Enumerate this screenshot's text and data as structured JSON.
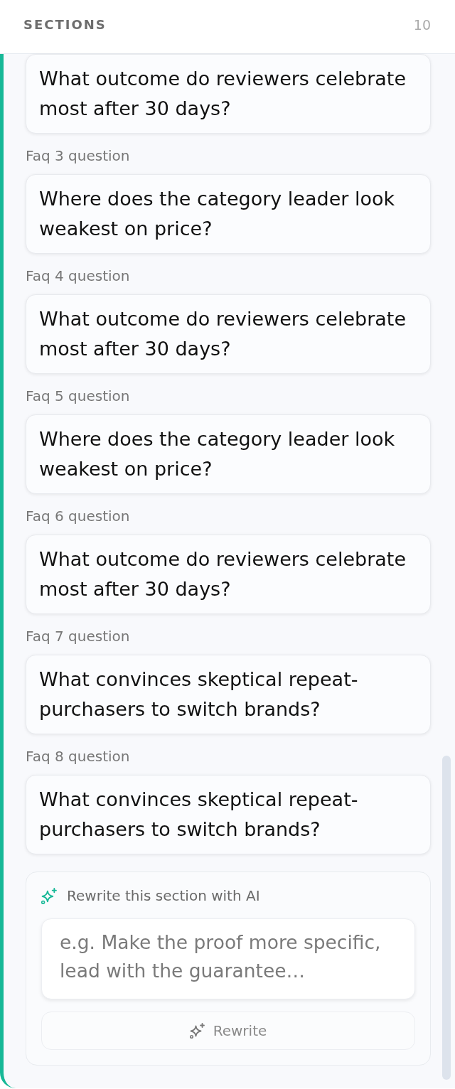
{
  "header": {
    "title": "SECTIONS",
    "count": "10"
  },
  "questions": [
    {
      "text": "What outcome do reviewers celebrate most after 30 days?"
    },
    {
      "label": "Faq 3 question",
      "text": "Where does the category leader look weakest on price?"
    },
    {
      "label": "Faq 4 question",
      "text": "What outcome do reviewers celebrate most after 30 days?"
    },
    {
      "label": "Faq 5 question",
      "text": "Where does the category leader look weakest on price?"
    },
    {
      "label": "Faq 6 question",
      "text": "What outcome do reviewers celebrate most after 30 days?"
    },
    {
      "label": "Faq 7 question",
      "text": "What convinces skeptical repeat-purchasers to switch brands?"
    },
    {
      "label": "Faq 8 question",
      "text": "What convinces skeptical repeat-purchasers to switch brands?"
    }
  ],
  "ai_rewrite": {
    "title": "Rewrite this section with AI",
    "placeholder": "e.g. Make the proof more specific, lead with the guarantee…",
    "button": {
      "label": "Rewrite",
      "disabled": true
    }
  }
}
